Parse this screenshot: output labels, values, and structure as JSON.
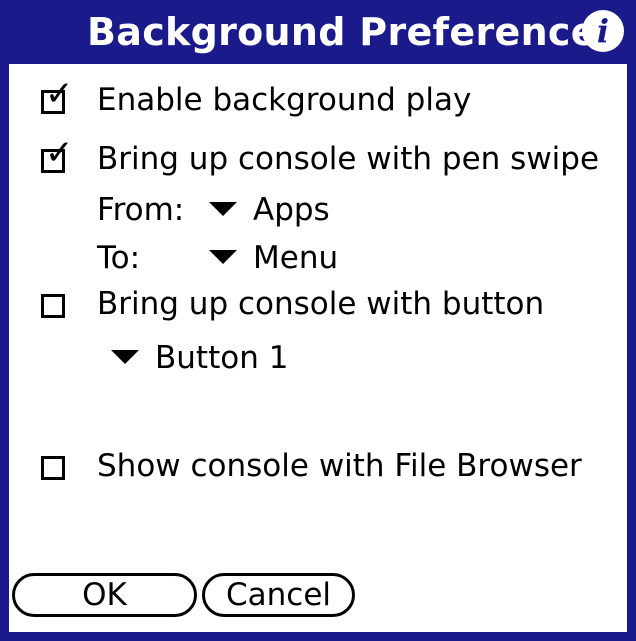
{
  "dialog": {
    "title": "Background Preferences",
    "info_icon": "info-icon"
  },
  "options": {
    "enable_background_play": {
      "label": "Enable background play",
      "checked": true
    },
    "pen_swipe": {
      "label": "Bring up console with pen swipe",
      "checked": true
    },
    "from_label": "From:",
    "from_value": "Apps",
    "to_label": "To:",
    "to_value": "Menu",
    "button_console": {
      "label": "Bring up console with button",
      "checked": false
    },
    "button_value": "Button 1",
    "file_browser": {
      "label": "Show console with File Browser",
      "checked": false
    }
  },
  "buttons": {
    "ok": "OK",
    "cancel": "Cancel"
  },
  "colors": {
    "title_bar": "#1b1a8a",
    "background": "#ffffff"
  }
}
